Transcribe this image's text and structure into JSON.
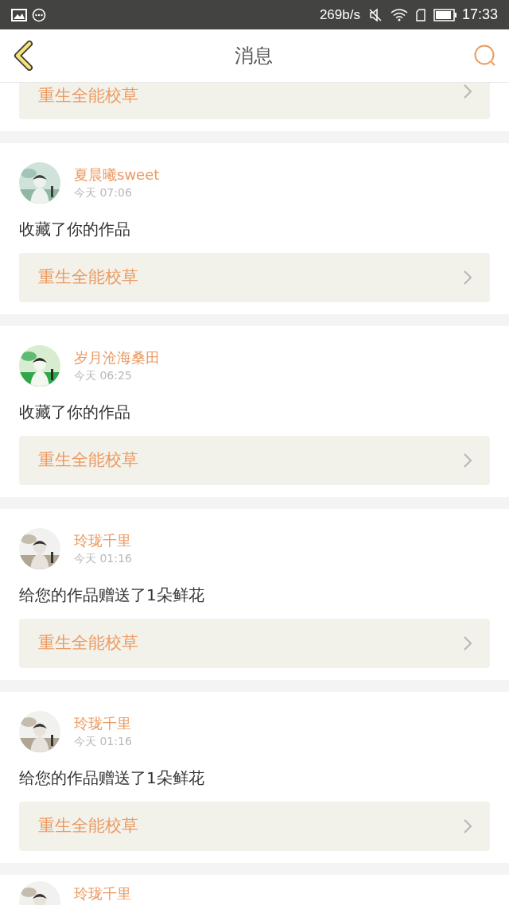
{
  "status_bar": {
    "speed": "269b/s",
    "time": "17:33"
  },
  "header": {
    "title": "消息"
  },
  "partial_top": {
    "work": "重生全能校草"
  },
  "messages": [
    {
      "name": "夏晨曦sweet",
      "time": "今天 07:06",
      "text": "收藏了你的作品",
      "work": "重生全能校草"
    },
    {
      "name": "岁月沧海桑田",
      "time": "今天 06:25",
      "text": "收藏了你的作品",
      "work": "重生全能校草"
    },
    {
      "name": "玲珑千里",
      "time": "今天 01:16",
      "text": "给您的作品赠送了1朵鲜花",
      "work": "重生全能校草"
    },
    {
      "name": "玲珑千里",
      "time": "今天 01:16",
      "text": "给您的作品赠送了1朵鲜花",
      "work": "重生全能校草"
    },
    {
      "name": "玲珑千里"
    }
  ]
}
